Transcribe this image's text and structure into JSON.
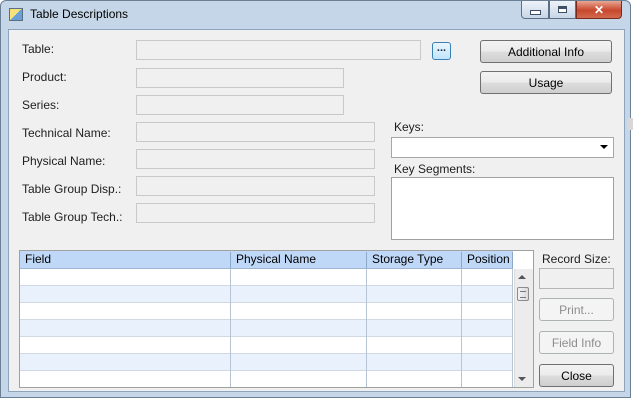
{
  "window": {
    "title": "Table Descriptions"
  },
  "labels": {
    "table": "Table:",
    "product": "Product:",
    "series": "Series:",
    "technical_name": "Technical Name:",
    "physical_name": "Physical Name:",
    "table_group_disp": "Table Group Disp.:",
    "table_group_tech": "Table Group Tech.:",
    "keys": "Keys:",
    "key_segments": "Key Segments:",
    "record_size": "Record Size:"
  },
  "fields": {
    "table": "",
    "product": "",
    "series": "",
    "technical_name": "",
    "physical_name": "",
    "table_group_disp": "",
    "table_group_tech": "",
    "keys_selected": "",
    "record_size": ""
  },
  "buttons": {
    "browse": "...",
    "additional_info": "Additional Info",
    "usage": "Usage",
    "print": "Print...",
    "field_info": "Field Info",
    "close": "Close"
  },
  "grid": {
    "columns": [
      "Field",
      "Physical Name",
      "Storage Type",
      "Position"
    ],
    "rows": [
      [
        "",
        "",
        "",
        ""
      ],
      [
        "",
        "",
        "",
        ""
      ],
      [
        "",
        "",
        "",
        ""
      ],
      [
        "",
        "",
        "",
        ""
      ],
      [
        "",
        "",
        "",
        ""
      ],
      [
        "",
        "",
        "",
        ""
      ],
      [
        "",
        "",
        "",
        ""
      ]
    ]
  }
}
